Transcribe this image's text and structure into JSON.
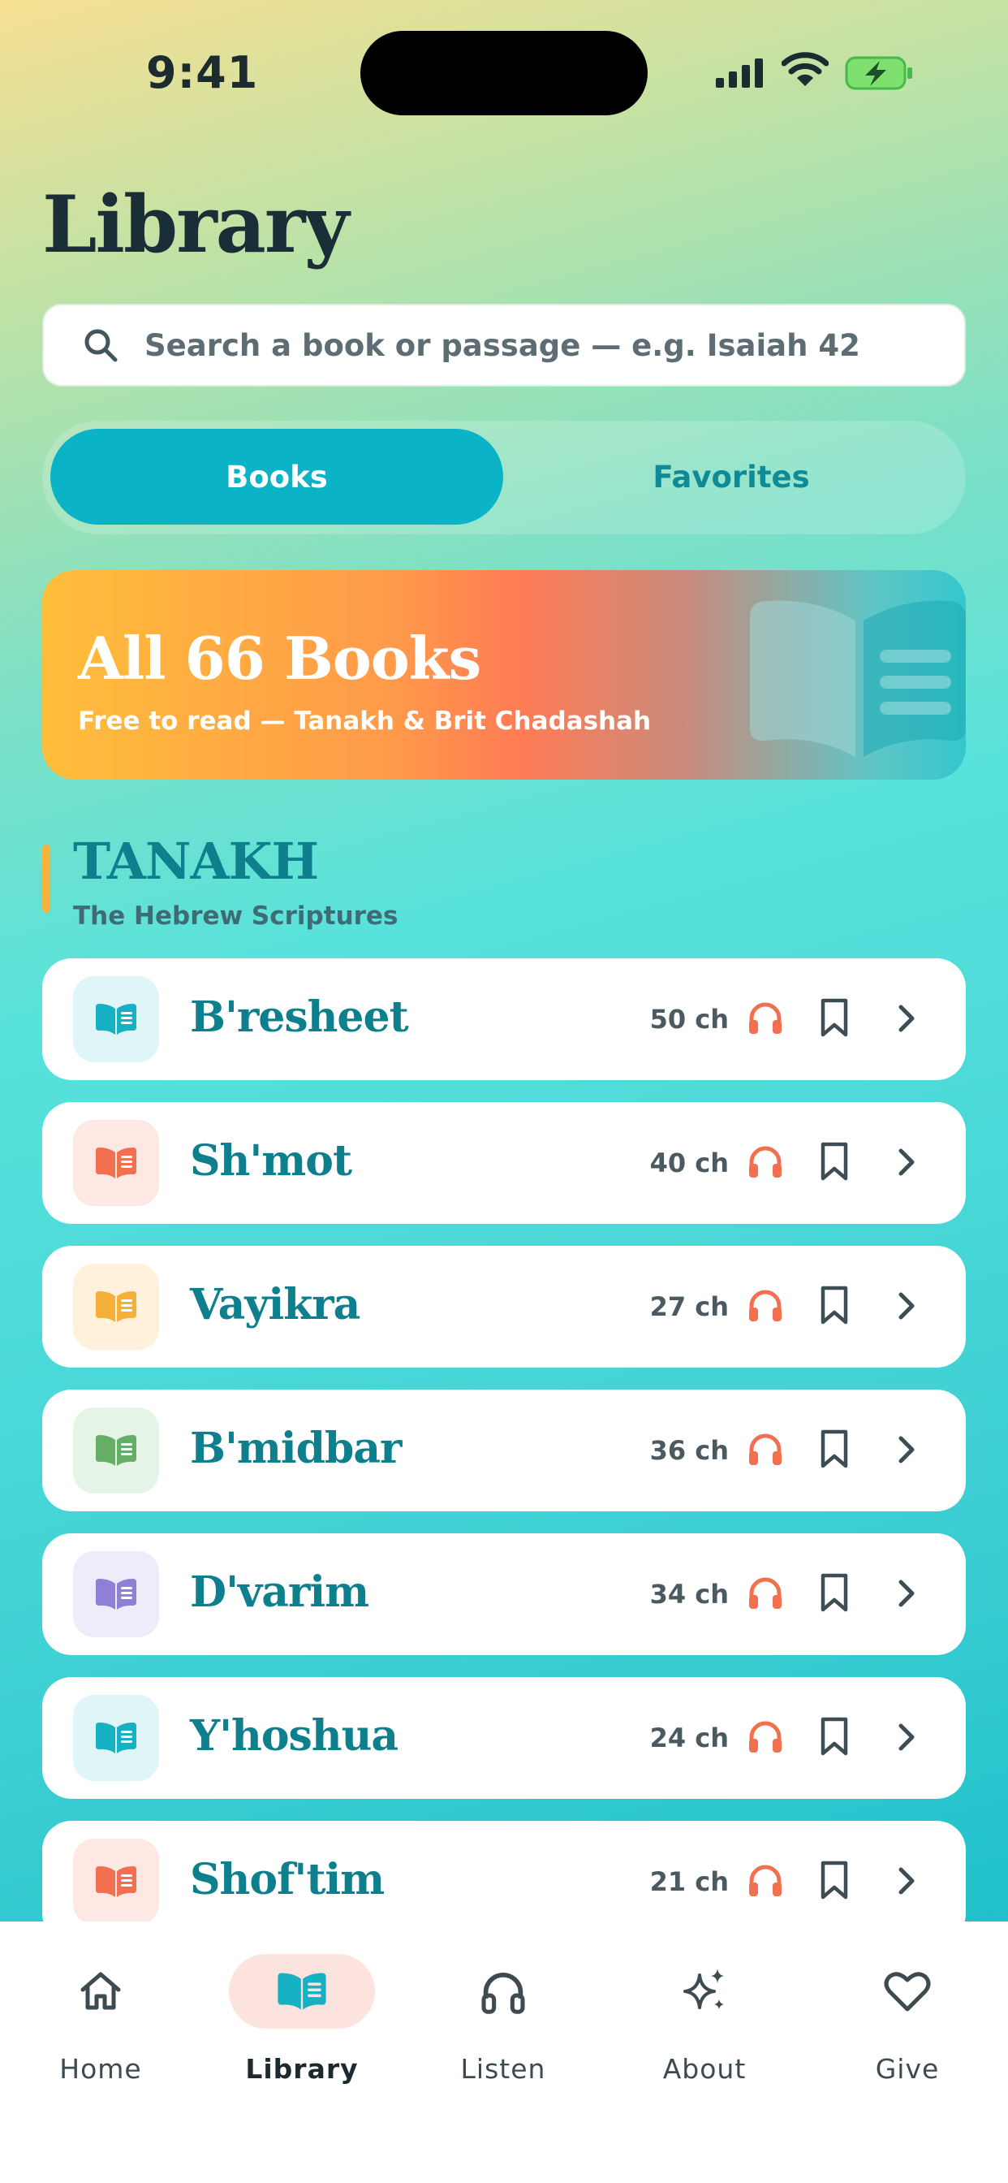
{
  "status_bar": {
    "time": "9:41"
  },
  "page_title": "Library",
  "search": {
    "placeholder": "Search a book or passage — e.g. Isaiah 42"
  },
  "tabs": [
    {
      "label": "Books",
      "selected": true
    },
    {
      "label": "Favorites",
      "selected": false
    }
  ],
  "hero": {
    "title": "All 66 Books",
    "subtitle": "Free to read — Tanakh & Brit Chadashah"
  },
  "section": {
    "title": "TANAKH",
    "subtitle": "The Hebrew Scriptures"
  },
  "books": [
    {
      "name": "B'resheet",
      "chapters": "50 ch",
      "tile_bg": "#dff5f7",
      "icon_color": "#17b1c4"
    },
    {
      "name": "Sh'mot",
      "chapters": "40 ch",
      "tile_bg": "#fde8e3",
      "icon_color": "#f2704f"
    },
    {
      "name": "Vayikra",
      "chapters": "27 ch",
      "tile_bg": "#fff1dc",
      "icon_color": "#f5b03a"
    },
    {
      "name": "B'midbar",
      "chapters": "36 ch",
      "tile_bg": "#e6f3e7",
      "icon_color": "#66ad66"
    },
    {
      "name": "D'varim",
      "chapters": "34 ch",
      "tile_bg": "#eeebfa",
      "icon_color": "#8f7fd6"
    },
    {
      "name": "Y'hoshua",
      "chapters": "24 ch",
      "tile_bg": "#dff5f7",
      "icon_color": "#17b1c4"
    },
    {
      "name": "Shof'tim",
      "chapters": "21 ch",
      "tile_bg": "#fde8e3",
      "icon_color": "#f2704f"
    }
  ],
  "nav": [
    {
      "label": "Home",
      "icon": "home-icon"
    },
    {
      "label": "Library",
      "icon": "book-icon",
      "active": true
    },
    {
      "label": "Listen",
      "icon": "headphones-icon"
    },
    {
      "label": "About",
      "icon": "sparkles-icon"
    },
    {
      "label": "Give",
      "icon": "heart-icon"
    }
  ],
  "colors": {
    "accent": "#0ab3c6",
    "audio": "#f2704f",
    "title_teal": "#0d7f8d"
  }
}
